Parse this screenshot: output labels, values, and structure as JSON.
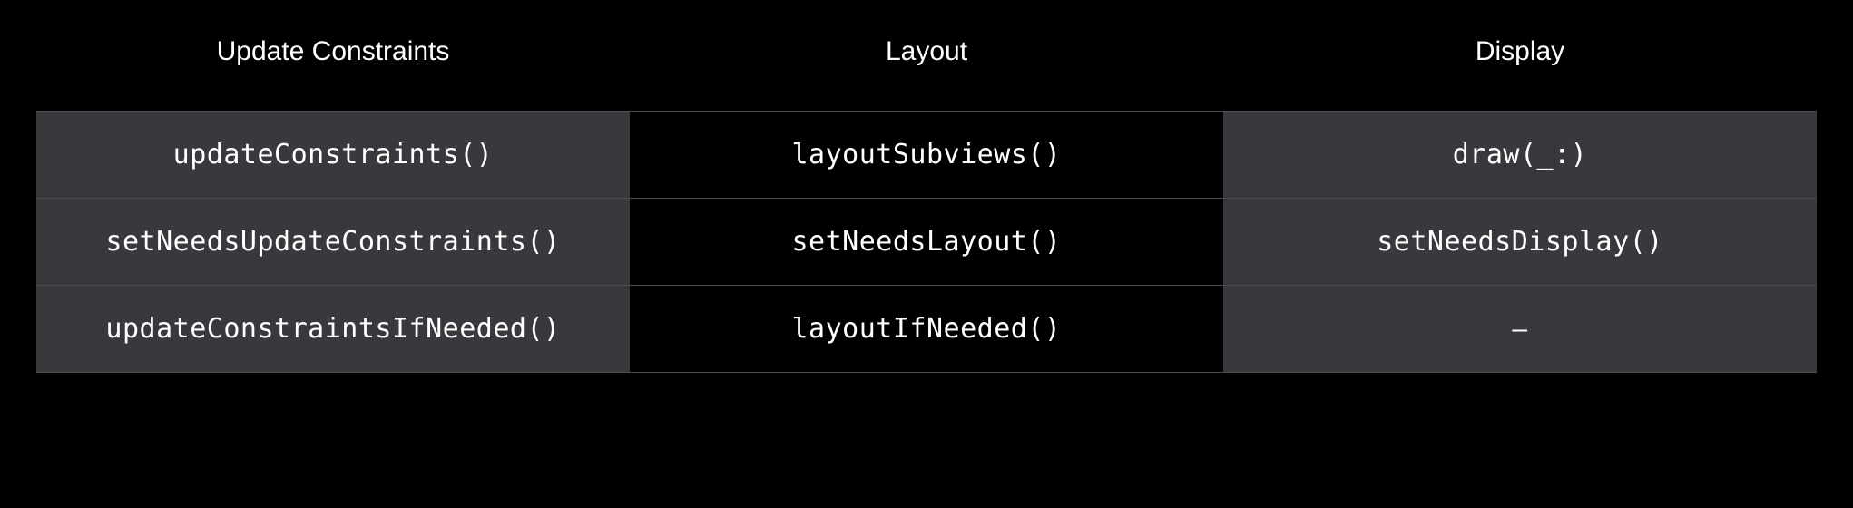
{
  "table": {
    "headers": [
      "Update Constraints",
      "Layout",
      "Display"
    ],
    "rows": [
      [
        "updateConstraints()",
        "layoutSubviews()",
        "draw(_:)"
      ],
      [
        "setNeedsUpdateConstraints()",
        "setNeedsLayout()",
        "setNeedsDisplay()"
      ],
      [
        "updateConstraintsIfNeeded()",
        "layoutIfNeeded()",
        "–"
      ]
    ]
  }
}
